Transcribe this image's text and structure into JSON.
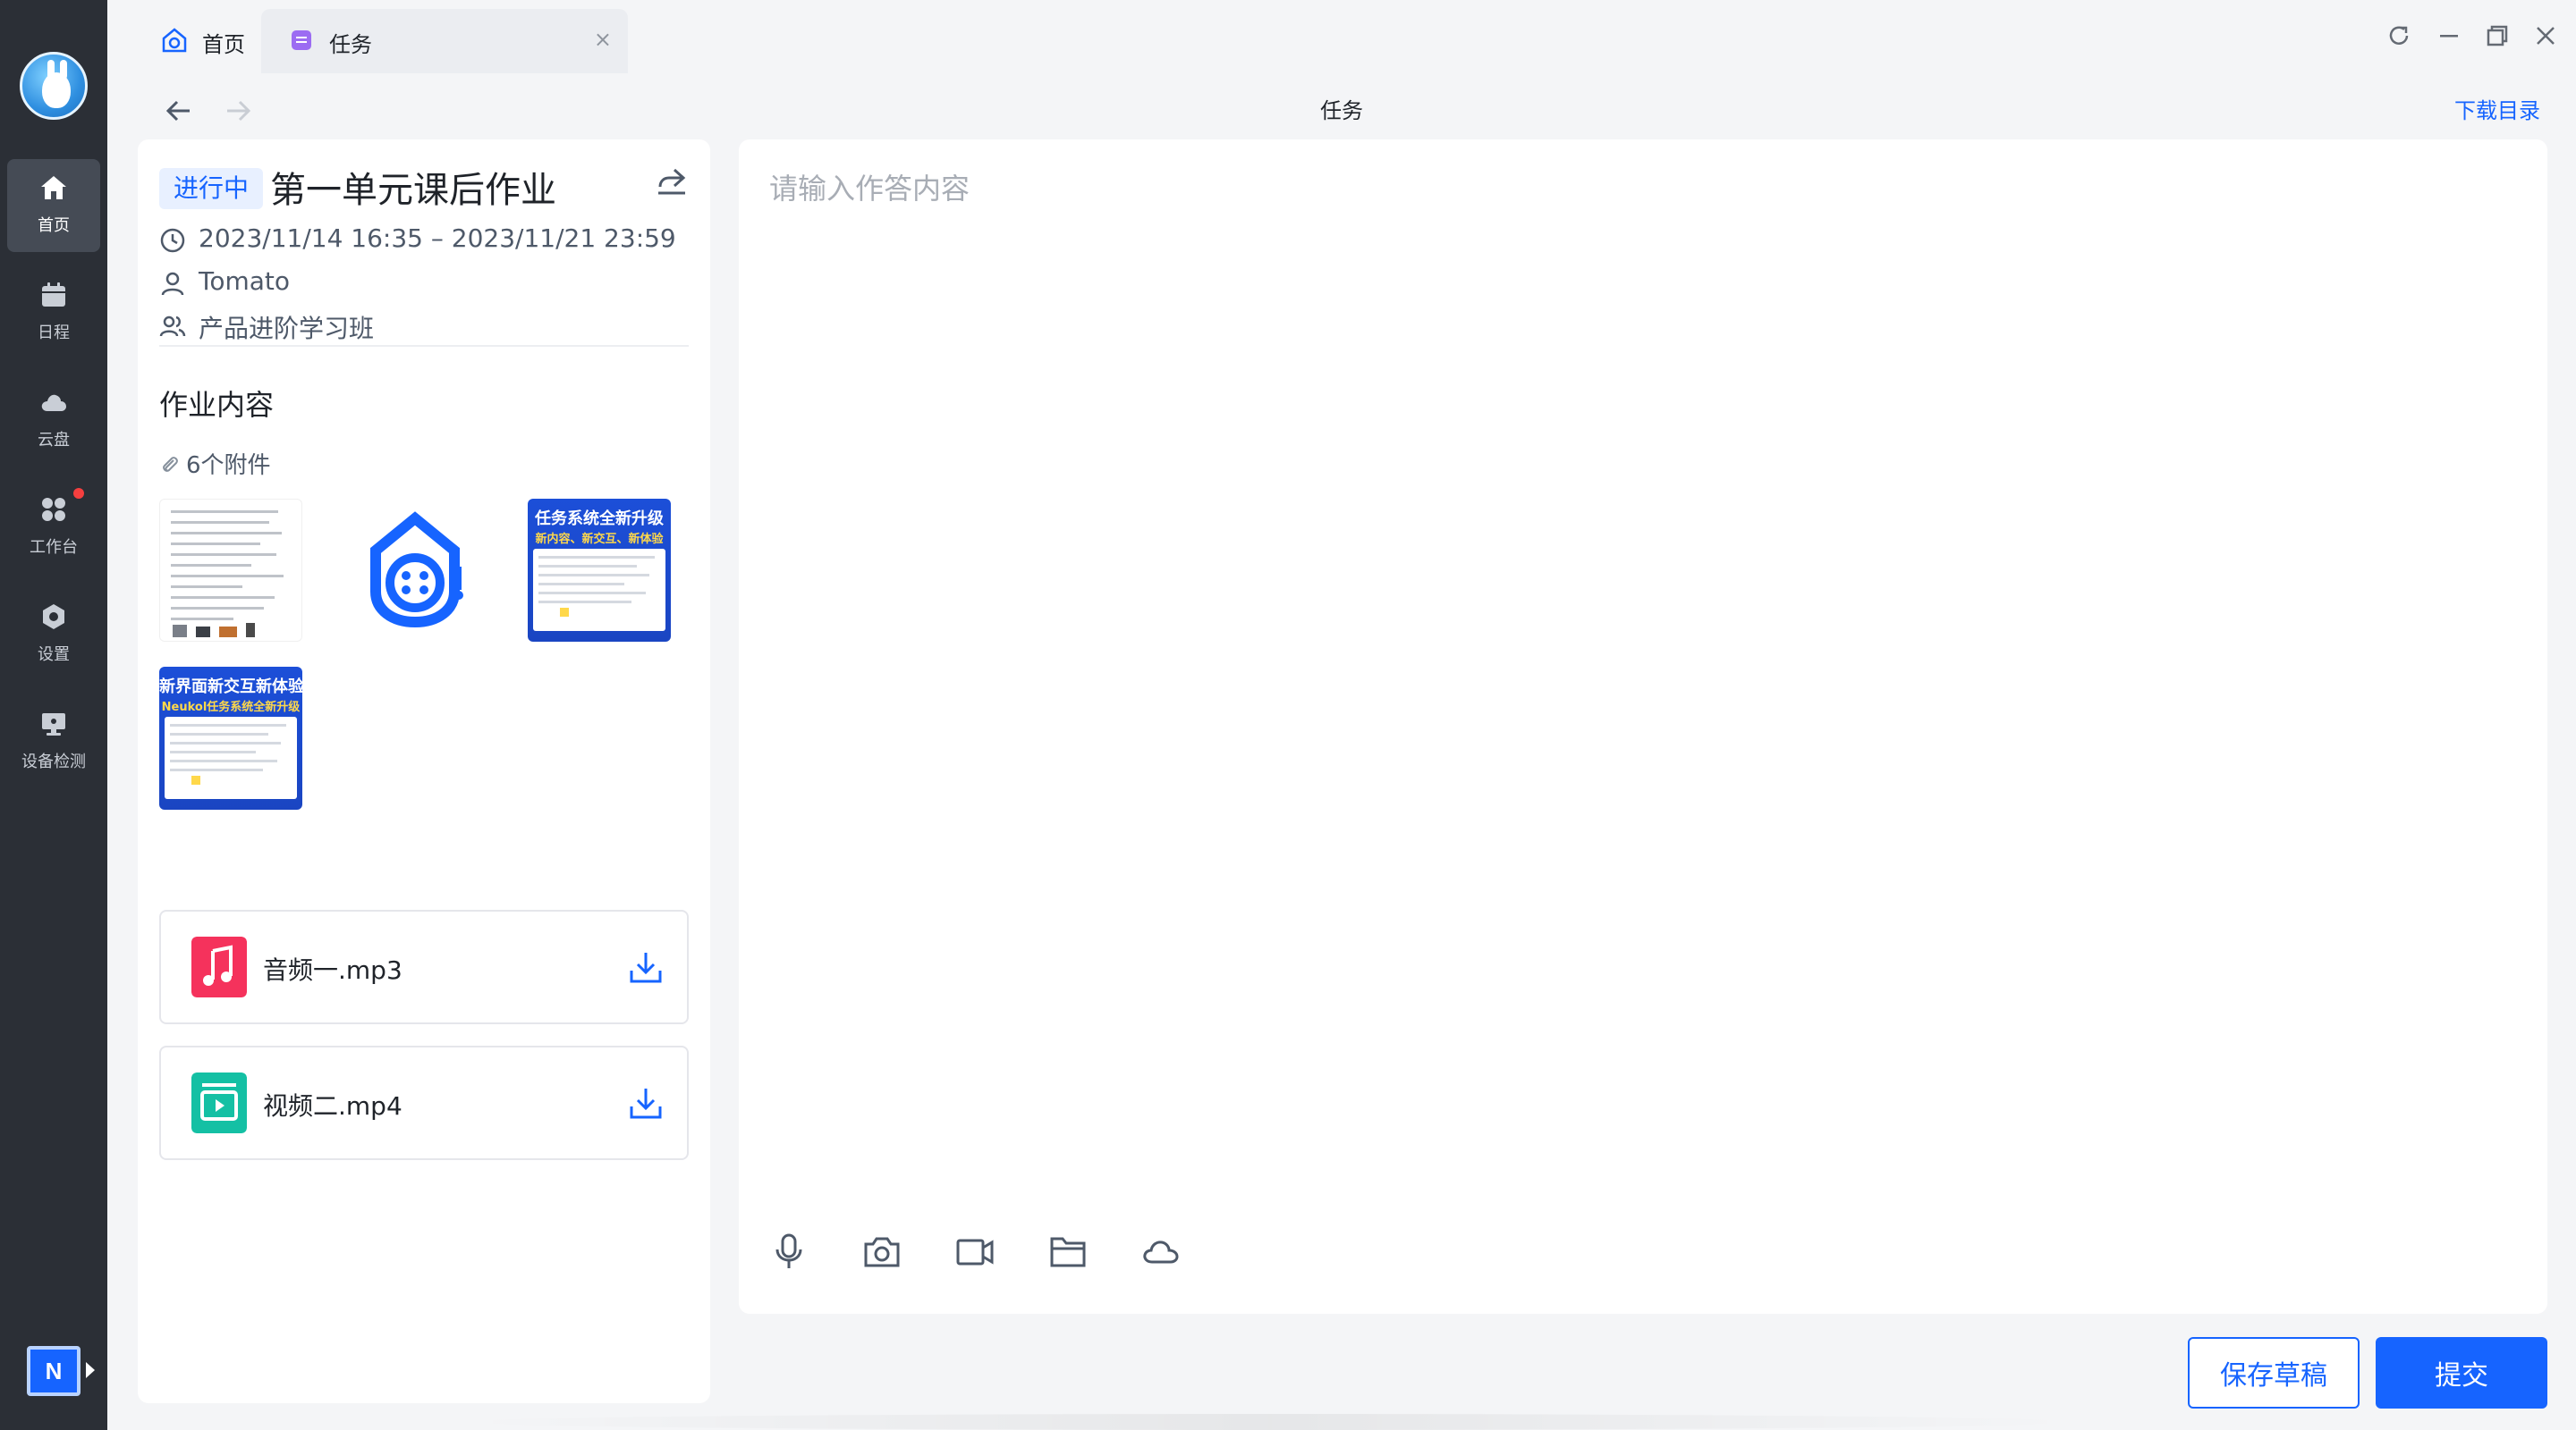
{
  "sidebar": {
    "items": [
      {
        "label": "首页",
        "icon": "home-icon",
        "active": true
      },
      {
        "label": "日程",
        "icon": "calendar-icon",
        "active": false
      },
      {
        "label": "云盘",
        "icon": "cloud-icon",
        "active": false
      },
      {
        "label": "工作台",
        "icon": "workbench-icon",
        "active": false,
        "badge": true
      },
      {
        "label": "设置",
        "icon": "settings-icon",
        "active": false
      },
      {
        "label": "设备检测",
        "icon": "device-check-icon",
        "active": false
      }
    ],
    "logo_letter": "N"
  },
  "tabs": [
    {
      "label": "首页",
      "icon": "home-tab-icon"
    },
    {
      "label": "任务",
      "icon": "task-tab-icon",
      "active": true
    }
  ],
  "tab_close": "×",
  "header": {
    "title": "任务",
    "download_dir": "下载目录"
  },
  "task": {
    "status": "进行中",
    "title": "第一单元课后作业",
    "time_range": "2023/11/14 16:35 – 2023/11/21 23:59",
    "author": "Tomato",
    "class_name": "产品进阶学习班"
  },
  "content": {
    "section_title": "作业内容",
    "attachment_count": "6个附件",
    "thumbnails": [
      {
        "type": "document"
      },
      {
        "type": "logo"
      },
      {
        "type": "banner",
        "text": "任务系统全新升级",
        "subtext": "新内容、新交互、新体验"
      },
      {
        "type": "banner",
        "text": "新界面新交互新体验",
        "subtext": "Neukol任务系统全新升级"
      }
    ],
    "files": [
      {
        "name": "音频一.mp3",
        "icon": "audio-file-icon",
        "color": "#f5325c"
      },
      {
        "name": "视频二.mp4",
        "icon": "video-file-icon",
        "color": "#14c0a4"
      }
    ]
  },
  "answer": {
    "placeholder": "请输入作答内容",
    "tools": [
      "microphone-icon",
      "camera-icon",
      "video-camera-icon",
      "folder-icon",
      "cloud-upload-icon"
    ]
  },
  "actions": {
    "save_draft": "保存草稿",
    "submit": "提交"
  },
  "colors": {
    "accent": "#1664ff",
    "sidebar_bg": "#2b2f36",
    "sidebar_active": "#454b55",
    "badge_red": "#f53f3f"
  }
}
